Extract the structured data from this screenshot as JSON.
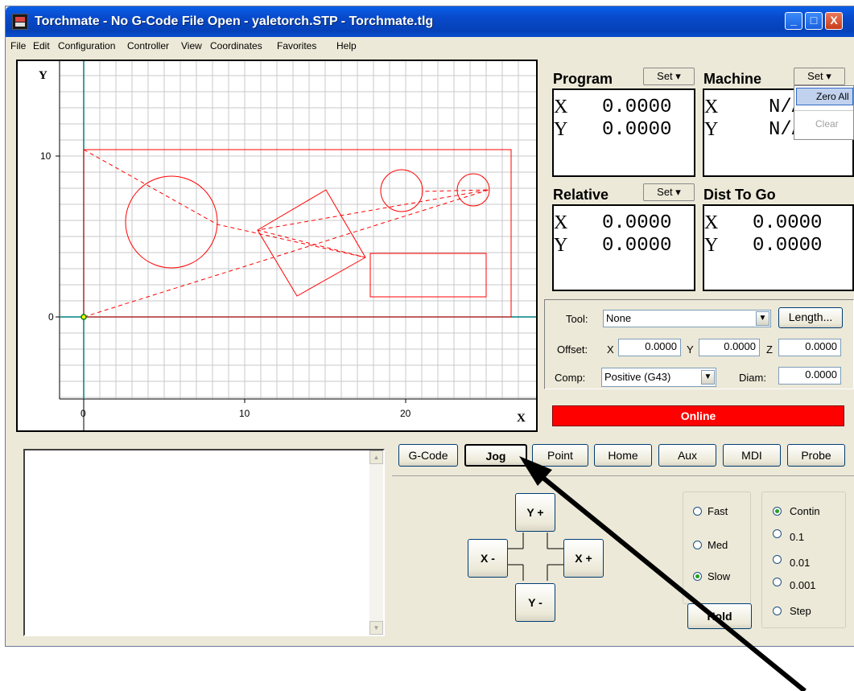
{
  "window": {
    "title": "Torchmate - No G-Code File Open - yaletorch.STP - Torchmate.tlg",
    "controls": {
      "minimize": "_",
      "maximize": "□",
      "close": "X"
    }
  },
  "menu": [
    "File",
    "Edit",
    "Configuration",
    "Controller",
    "View",
    "Coordinates",
    "Favorites",
    "Help"
  ],
  "plot": {
    "x_axis_label": "X",
    "y_axis_label": "Y",
    "x_ticks": [
      "0",
      "10",
      "20"
    ],
    "y_ticks": [
      "10",
      "0"
    ]
  },
  "dro": {
    "program": {
      "label": "Program",
      "set": "Set",
      "x_axis": "X",
      "x": "0.0000",
      "y_axis": "Y",
      "y": "0.0000"
    },
    "machine": {
      "label": "Machine",
      "set": "Set",
      "x_axis": "X",
      "x": "N/A",
      "y_axis": "Y",
      "y": "N/A"
    },
    "relative": {
      "label": "Relative",
      "set": "Set",
      "x_axis": "X",
      "x": "0.0000",
      "y_axis": "Y",
      "y": "0.0000"
    },
    "dist_to_go": {
      "label": "Dist To Go",
      "x_axis": "X",
      "x": "0.0000",
      "y_axis": "Y",
      "y": "0.0000"
    },
    "machine_menu": {
      "zero_all": "Zero All",
      "clear": "Clear"
    }
  },
  "tool": {
    "tool_label": "Tool:",
    "tool_value": "None",
    "length_button": "Length...",
    "offset_label": "Offset:",
    "offset_x_label": "X",
    "offset_x": "0.0000",
    "offset_y_label": "Y",
    "offset_y": "0.0000",
    "offset_z_label": "Z",
    "offset_z": "0.0000",
    "comp_label": "Comp:",
    "comp_value": "Positive (G43)",
    "diam_label": "Diam:",
    "diam": "0.0000"
  },
  "status": {
    "text": "Online",
    "color": "#ff0000"
  },
  "tabs": [
    "G-Code",
    "Jog",
    "Point",
    "Home",
    "Aux",
    "MDI",
    "Probe"
  ],
  "active_tab": "Jog",
  "jog": {
    "y_plus": "Y +",
    "y_minus": "Y -",
    "x_minus": "X -",
    "x_plus": "X +",
    "speed": [
      {
        "label": "Fast",
        "selected": false
      },
      {
        "label": "Med",
        "selected": false
      },
      {
        "label": "Slow",
        "selected": true
      }
    ],
    "increment": [
      {
        "label": "Contin",
        "selected": true
      },
      {
        "label": "0.1",
        "selected": false
      },
      {
        "label": "0.01",
        "selected": false
      },
      {
        "label": "0.001",
        "selected": false
      },
      {
        "label": "Step",
        "selected": false
      }
    ],
    "hold": "Hold"
  },
  "colors": {
    "accent": "#0a50d8",
    "geometry": "#ff0000",
    "axis": "#008080",
    "background": "#ece9d8"
  }
}
